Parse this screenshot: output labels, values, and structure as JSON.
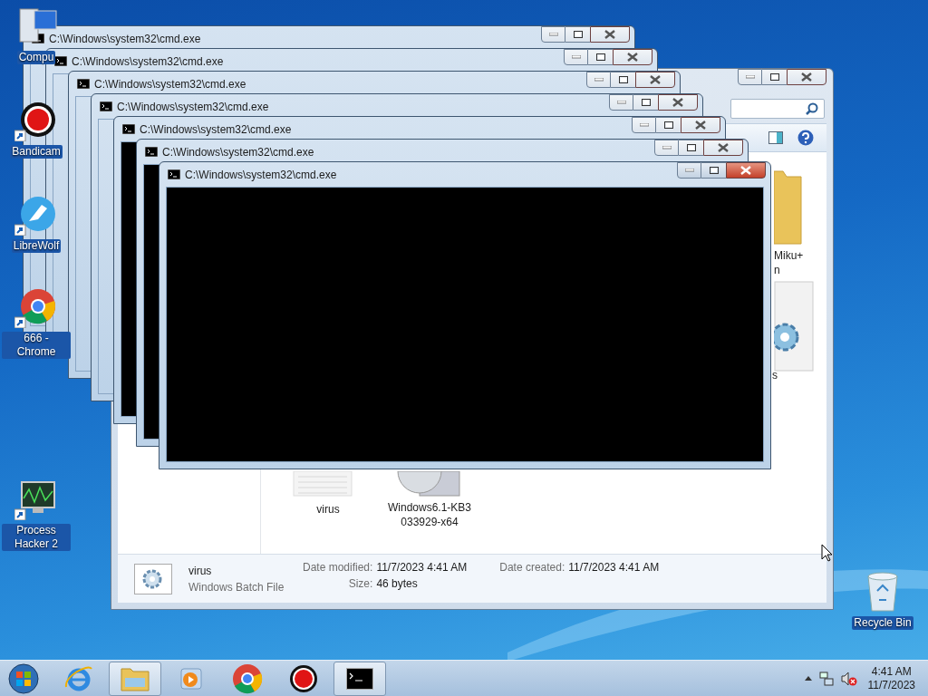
{
  "desktop_icons": [
    {
      "label": "Compu",
      "kind": "computer"
    },
    {
      "label": "Bandicam",
      "kind": "bandicam"
    },
    {
      "label": "LibreWolf",
      "kind": "librewolf"
    },
    {
      "label": "666 - Chrome",
      "kind": "chrome"
    },
    {
      "label": "Process Hacker 2",
      "kind": "processhacker"
    },
    {
      "label": "Recycle Bin",
      "kind": "recycle"
    }
  ],
  "explorer": {
    "items": [
      {
        "kind": "folder",
        "label_lines": [
          "Miku+",
          "n"
        ]
      },
      {
        "kind": "settings",
        "label_lines": [
          "s"
        ]
      },
      {
        "kind": "batch",
        "label_lines": [
          "virus"
        ]
      },
      {
        "kind": "installer",
        "label_lines": [
          "Windows6.1-KB3",
          "033929-x64"
        ]
      }
    ],
    "details": {
      "name": "virus",
      "type": "Windows Batch File",
      "fields": [
        {
          "label": "Date modified:",
          "value": "11/7/2023 4:41 AM"
        },
        {
          "label": "Size:",
          "value": "46 bytes"
        },
        {
          "label": "Date created:",
          "value": "11/7/2023 4:41 AM"
        }
      ]
    }
  },
  "cmd_windows": [
    {
      "title": "C:\\Windows\\system32\\cmd.exe"
    },
    {
      "title": "C:\\Windows\\system32\\cmd.exe"
    },
    {
      "title": "C:\\Windows\\system32\\cmd.exe"
    },
    {
      "title": "C:\\Windows\\system32\\cmd.exe"
    },
    {
      "title": "C:\\Windows\\system32\\cmd.exe"
    },
    {
      "title": "C:\\Windows\\system32\\cmd.exe"
    },
    {
      "title": "C:\\Windows\\system32\\cmd.exe"
    }
  ],
  "taskbar": {
    "items": [
      {
        "kind": "ie",
        "highlighted": false
      },
      {
        "kind": "explorer",
        "highlighted": true
      },
      {
        "kind": "media",
        "highlighted": false
      },
      {
        "kind": "chrome",
        "highlighted": false
      },
      {
        "kind": "bandicam",
        "highlighted": false
      },
      {
        "kind": "cmd",
        "highlighted": true
      }
    ],
    "clock": {
      "time": "4:41 AM",
      "date": "11/7/2023"
    }
  }
}
